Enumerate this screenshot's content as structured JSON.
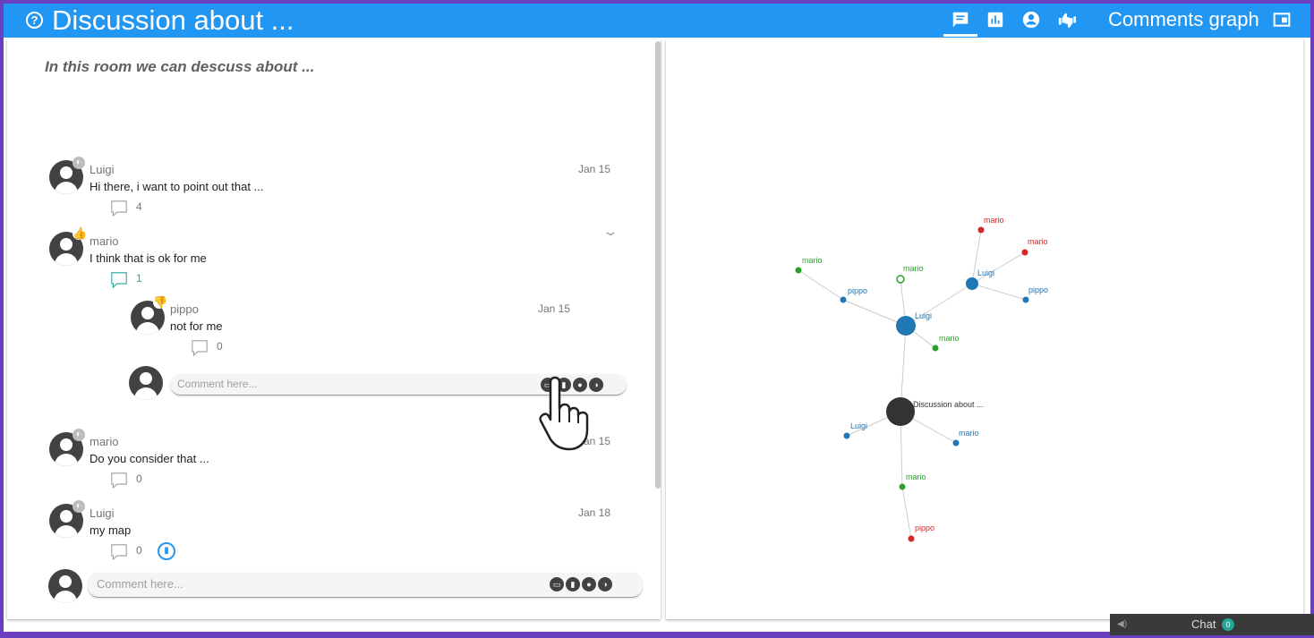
{
  "header": {
    "title": "Discussion about ...",
    "graph_label": "Comments graph",
    "icons": [
      "comments-icon",
      "chart-icon",
      "account-icon",
      "thumbs-icon",
      "graph-toggle-icon"
    ]
  },
  "room": {
    "description": "In this room we can descuss about ..."
  },
  "comments": [
    {
      "author": "Luigi",
      "text": "Hi there, i want to point out that ...",
      "date": "Jan 15",
      "replies": "4",
      "badge": "neutral"
    },
    {
      "author": "mario",
      "text": "I think that is ok for me",
      "date": "",
      "replies": "1",
      "badge": "thumbs-up"
    },
    {
      "author": "pippo",
      "text": "not for me",
      "date": "Jan 15",
      "replies": "0",
      "badge": "thumbs-down"
    },
    {
      "author": "mario",
      "text": "Do you consider that ...",
      "date": "Jan 15",
      "replies": "0",
      "badge": "neutral"
    },
    {
      "author": "Luigi",
      "text": "my map",
      "date": "Jan 18",
      "replies": "0",
      "badge": "neutral"
    }
  ],
  "comment_input": {
    "placeholder": "Comment here..."
  },
  "chat": {
    "label": "Chat",
    "count": "0"
  },
  "graph": {
    "nodes": [
      {
        "label": "Discussion about ...",
        "color": "#333333"
      },
      {
        "label": "Luigi",
        "color": "#1f77b4"
      },
      {
        "label": "Luigi",
        "color": "#1f77b4"
      },
      {
        "label": "mario",
        "color": "#2ca02c"
      },
      {
        "label": "pippo",
        "color": "#1f77b4"
      },
      {
        "label": "mario",
        "color": "#2ca02c"
      },
      {
        "label": "mario",
        "color": "#2ca02c"
      },
      {
        "label": "mario",
        "color": "#d62728"
      },
      {
        "label": "mario",
        "color": "#d62728"
      },
      {
        "label": "pippo",
        "color": "#1f77b4"
      },
      {
        "label": "Luigi",
        "color": "#1f77b4"
      },
      {
        "label": "mario",
        "color": "#1f77b4"
      },
      {
        "label": "mario",
        "color": "#2ca02c"
      },
      {
        "label": "pippo",
        "color": "#d62728"
      }
    ],
    "colors": {
      "blue": "#1f77b4",
      "green": "#2ca02c",
      "red": "#d62728",
      "root": "#333333"
    }
  }
}
